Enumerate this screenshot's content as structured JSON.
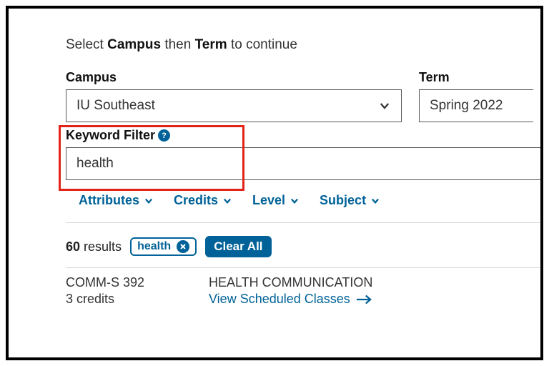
{
  "instruction": {
    "pre": "Select ",
    "b1": "Campus",
    "mid": " then ",
    "b2": "Term",
    "post": " to continue"
  },
  "campus": {
    "label": "Campus",
    "value": "IU Southeast"
  },
  "term": {
    "label": "Term",
    "value": "Spring 2022"
  },
  "keyword": {
    "label": "Keyword Filter",
    "help": "?",
    "value": "health"
  },
  "filters": {
    "attributes": "Attributes",
    "credits": "Credits",
    "level": "Level",
    "subject": "Subject"
  },
  "results": {
    "count": "60",
    "count_label": " results",
    "chip": "health",
    "clear_all": "Clear All"
  },
  "course": {
    "code": "COMM-S 392",
    "credits": "3 credits",
    "title": "HEALTH COMMUNICATION",
    "view": "View Scheduled Classes"
  }
}
